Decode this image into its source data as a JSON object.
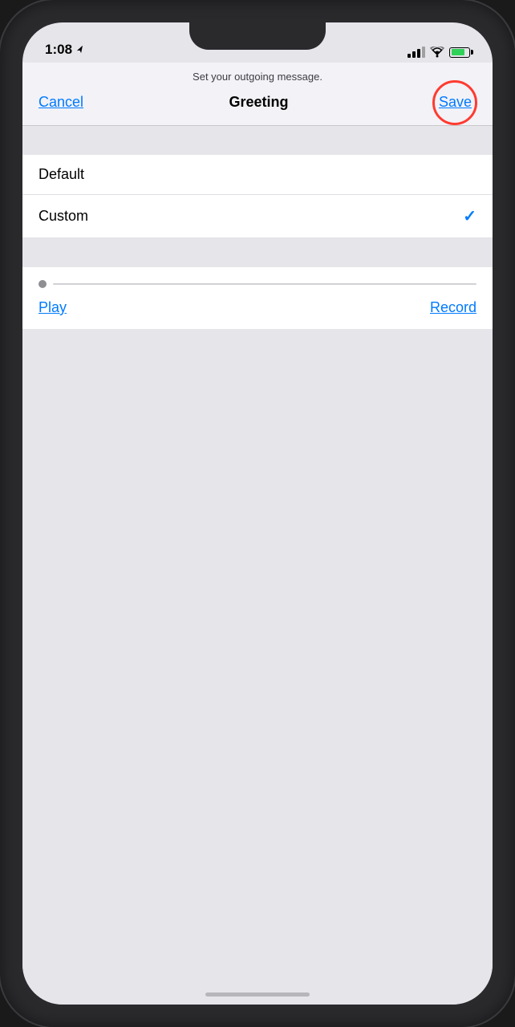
{
  "status_bar": {
    "time": "1:08",
    "location_icon": "◀",
    "battery_level": 80
  },
  "nav": {
    "subtitle": "Set your outgoing message.",
    "cancel_label": "Cancel",
    "title": "Greeting",
    "save_label": "Save"
  },
  "list": {
    "items": [
      {
        "label": "Default",
        "checked": false
      },
      {
        "label": "Custom",
        "checked": true
      }
    ]
  },
  "audio": {
    "play_label": "Play",
    "record_label": "Record"
  }
}
